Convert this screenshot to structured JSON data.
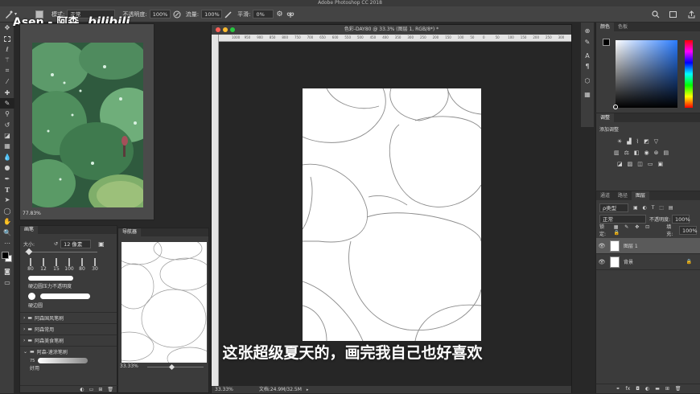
{
  "app": {
    "title": "Adobe Photoshop CC 2018"
  },
  "watermark": {
    "text": "Asen - 阿森",
    "brand": "bilibili"
  },
  "options_bar": {
    "mode_label": "模式:",
    "mode_value": "正常",
    "opacity_label": "不透明度:",
    "opacity_value": "100%",
    "flow_label": "流量:",
    "flow_value": "100%",
    "smooth_label": "平滑:",
    "smooth_value": "0%"
  },
  "tools": [
    "move-icon",
    "marquee-icon",
    "lasso-icon",
    "magic-wand-icon",
    "crop-icon",
    "eyedropper-icon",
    "healing-icon",
    "brush-icon",
    "stamp-icon",
    "history-brush-icon",
    "eraser-icon",
    "gradient-icon",
    "blur-icon",
    "dodge-icon",
    "pen-icon",
    "type-icon",
    "path-select-icon",
    "shape-icon",
    "hand-icon",
    "zoom-icon",
    "more-icon",
    "color-swatch-icon",
    "quickmask-icon",
    "screenmode-icon"
  ],
  "image_window": {
    "zoom": "77.83%"
  },
  "canvas_window": {
    "title": "色彩-DAY80 @ 33.3% (图层 1, RGB/8*) *",
    "ruler_marks": [
      "1000",
      "950",
      "900",
      "850",
      "800",
      "750",
      "700",
      "650",
      "600",
      "550",
      "500",
      "450",
      "400",
      "350",
      "300",
      "250",
      "200",
      "150",
      "100",
      "50",
      "0",
      "50",
      "100",
      "150",
      "200",
      "250",
      "300"
    ],
    "zoom": "33.33%",
    "doc_info": "文档:24.9M/32.5M"
  },
  "brush_panel": {
    "tab": "画笔",
    "size_label": "大小:",
    "size_value": "12 像素",
    "preset_sizes": [
      "80",
      "12",
      "15",
      "100",
      "80",
      "30"
    ],
    "preset1": "硬边圆压力不透明度",
    "preset2": "硬边圆",
    "groups": [
      "阿森国风笔刷",
      "阿森常用",
      "阿森美食笔刷",
      "阿森-速涂笔刷"
    ],
    "sub_preset": "好用",
    "sub_size": "75"
  },
  "navigator": {
    "tab": "导航器",
    "zoom": "33.33%"
  },
  "color_panel": {
    "tabs": [
      "颜色",
      "色板"
    ]
  },
  "adjust_panel": {
    "tab": "调整",
    "label": "添加调整"
  },
  "layers_panel": {
    "tabs": [
      "通道",
      "路径",
      "图层"
    ],
    "kind_label": "ρ类型",
    "blend_mode": "正常",
    "opacity_label": "不透明度:",
    "opacity_value": "100%",
    "lock_label": "锁定:",
    "fill_label": "填充:",
    "fill_value": "100%",
    "layers": [
      {
        "name": "图层 1"
      },
      {
        "name": "背景"
      }
    ],
    "bottom_icons": [
      "fx"
    ]
  },
  "subtitle": "这张超级夏天的，画完我自己也好喜欢"
}
